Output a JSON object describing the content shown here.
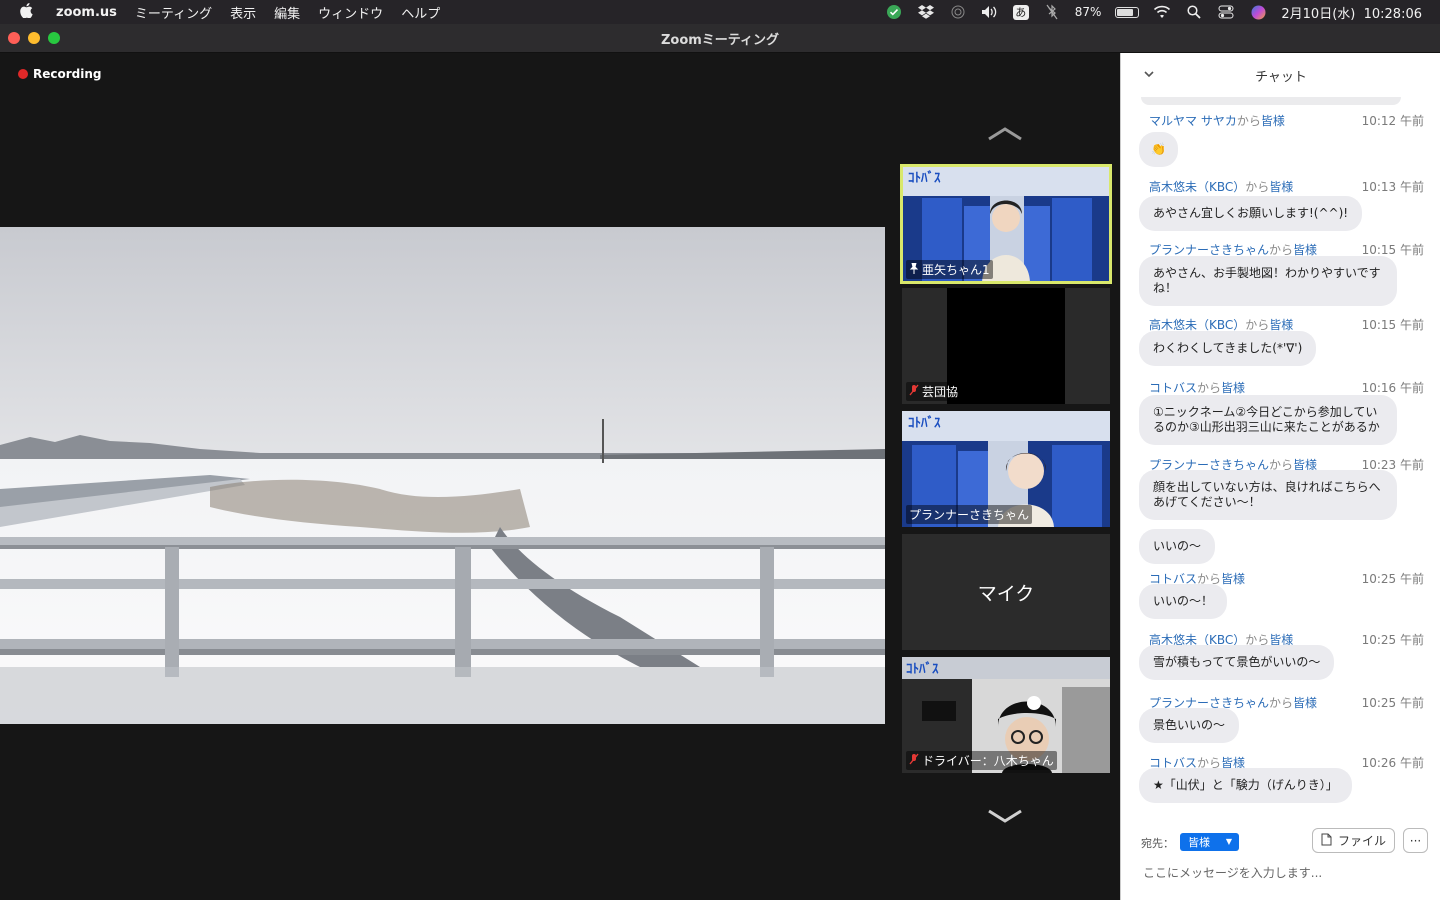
{
  "menubar": {
    "app": "zoom.us",
    "items": [
      "ミーティング",
      "表示",
      "編集",
      "ウィンドウ",
      "ヘルプ"
    ],
    "ime": "あ",
    "battery": "87%",
    "datetime": "2月10日(水)  10:28:06"
  },
  "window": {
    "title": "Zoomミーティング"
  },
  "meeting": {
    "recording_label": "Recording",
    "tiles": [
      {
        "name": "亜矢ちゃん1",
        "pinned": true
      },
      {
        "name": "芸団協",
        "muted": true
      },
      {
        "name": "プランナーさきちゃん"
      },
      {
        "name": "マイク"
      },
      {
        "name": "ドライバー：八木ちゃん",
        "muted": true
      }
    ]
  },
  "chat": {
    "title": "チャット",
    "from_word": "から",
    "messages": [
      {
        "sender": "マルヤマ サヤカ",
        "to": "皆様",
        "time": "10:12 午前",
        "text": "👏"
      },
      {
        "sender": "高木悠未（KBC）",
        "to": "皆様",
        "time": "10:13 午前",
        "text": "あやさん宜しくお願いします!(^^)!"
      },
      {
        "sender": "プランナーさきちゃん",
        "to": "皆様",
        "time": "10:15 午前",
        "text": "あやさん、お手製地図！わかりやすいですね！"
      },
      {
        "sender": "高木悠未（KBC）",
        "to": "皆様",
        "time": "10:15 午前",
        "text": "わくわくしてきました(*'∇')"
      },
      {
        "sender": "コトバス",
        "to": "皆様",
        "time": "10:16 午前",
        "text": "①ニックネーム②今日どこから参加しているのか③山形出羽三山に来たことがあるか"
      },
      {
        "sender": "プランナーさきちゃん",
        "to": "皆様",
        "time": "10:23 午前",
        "text": "顔を出していない方は、良ければこちらへあげてください〜！"
      },
      {
        "continuation": true,
        "text": "いいの〜"
      },
      {
        "sender": "コトバス",
        "to": "皆様",
        "time": "10:25 午前",
        "text": "いいの〜！"
      },
      {
        "sender": "高木悠未（KBC）",
        "to": "皆様",
        "time": "10:25 午前",
        "text": "雪が積もってて景色がいいの〜"
      },
      {
        "sender": "プランナーさきちゃん",
        "to": "皆様",
        "time": "10:25 午前",
        "text": "景色いいの〜"
      },
      {
        "sender": "コトバス",
        "to": "皆様",
        "time": "10:26 午前",
        "text": "★「山伏」と「験力（げんりき）」"
      }
    ],
    "footer": {
      "to_label": "宛先：",
      "to_value": "皆様",
      "file_label": "ファイル",
      "more_label": "···",
      "input_placeholder": "ここにメッセージを入力します..."
    }
  }
}
